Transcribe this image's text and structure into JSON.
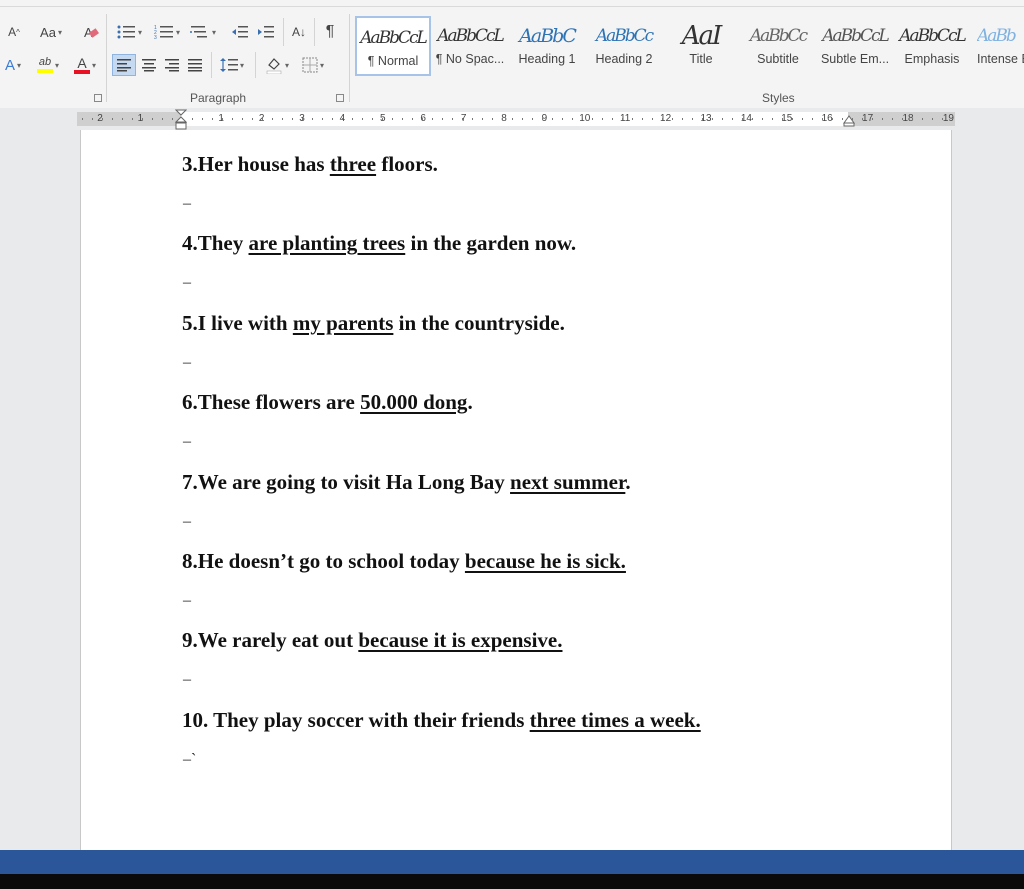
{
  "ribbon": {
    "groups": {
      "paragraph": "Paragraph",
      "styles": "Styles"
    },
    "font_tools": {
      "grow_font": "A",
      "change_case": "Aa",
      "text_effects": "A",
      "highlight": "ab",
      "font_color": "A"
    },
    "sort_label": "A↓",
    "pilcrow": "¶",
    "styles": [
      {
        "name": "¶ Normal",
        "sample": "AaBbCcL"
      },
      {
        "name": "¶ No Spac...",
        "sample": "AaBbCcL"
      },
      {
        "name": "Heading 1",
        "sample": "AaBbC"
      },
      {
        "name": "Heading 2",
        "sample": "AaBbCc"
      },
      {
        "name": "Title",
        "sample": "AaI"
      },
      {
        "name": "Subtitle",
        "sample": "AaBbCc"
      },
      {
        "name": "Subtle Em...",
        "sample": "AaBbCcL"
      },
      {
        "name": "Emphasis",
        "sample": "AaBbCcL"
      },
      {
        "name": "Intense E",
        "sample": "AaBb"
      }
    ],
    "colors": {
      "highlight": "#ffff00",
      "font_color": "#e81123",
      "accent": "#2b579a"
    }
  },
  "ruler": {
    "labels": [
      "2",
      "1",
      "1",
      "2",
      "3",
      "4",
      "5",
      "6",
      "7",
      "8",
      "9",
      "10",
      "11",
      "12",
      "13",
      "14",
      "15",
      "16",
      "17",
      "18",
      "19"
    ]
  },
  "document": {
    "items": [
      {
        "num": "3.",
        "parts": [
          {
            "t": "Her house has "
          },
          {
            "t": "three",
            "u": true
          },
          {
            "t": " floors."
          }
        ]
      },
      {
        "num": "4.",
        "parts": [
          {
            "t": "They "
          },
          {
            "t": "are planting trees",
            "u": true
          },
          {
            "t": " in the garden now."
          }
        ]
      },
      {
        "num": "5.",
        "parts": [
          {
            "t": "I live with "
          },
          {
            "t": "my parents",
            "u": true
          },
          {
            "t": " in the countryside."
          }
        ]
      },
      {
        "num": "6.",
        "parts": [
          {
            "t": "These flowers are "
          },
          {
            "t": "50.000 dong",
            "u": true
          },
          {
            "t": "."
          }
        ]
      },
      {
        "num": "7.",
        "parts": [
          {
            "t": "We are going to visit Ha Long Bay "
          },
          {
            "t": "next summer",
            "u": true
          },
          {
            "t": "."
          }
        ]
      },
      {
        "num": "8.",
        "parts": [
          {
            "t": "He doesn’t go to school today "
          },
          {
            "t": "because he is sick.",
            "u": true
          }
        ]
      },
      {
        "num": "9.",
        "parts": [
          {
            "t": "We rarely eat out "
          },
          {
            "t": "because it is expensive.",
            "u": true
          }
        ]
      },
      {
        "num": "10. ",
        "parts": [
          {
            "t": "They play soccer with their friends "
          },
          {
            "t": "three times a week.",
            "u": true
          }
        ]
      }
    ],
    "dash": "–",
    "last_dash": "–`"
  }
}
